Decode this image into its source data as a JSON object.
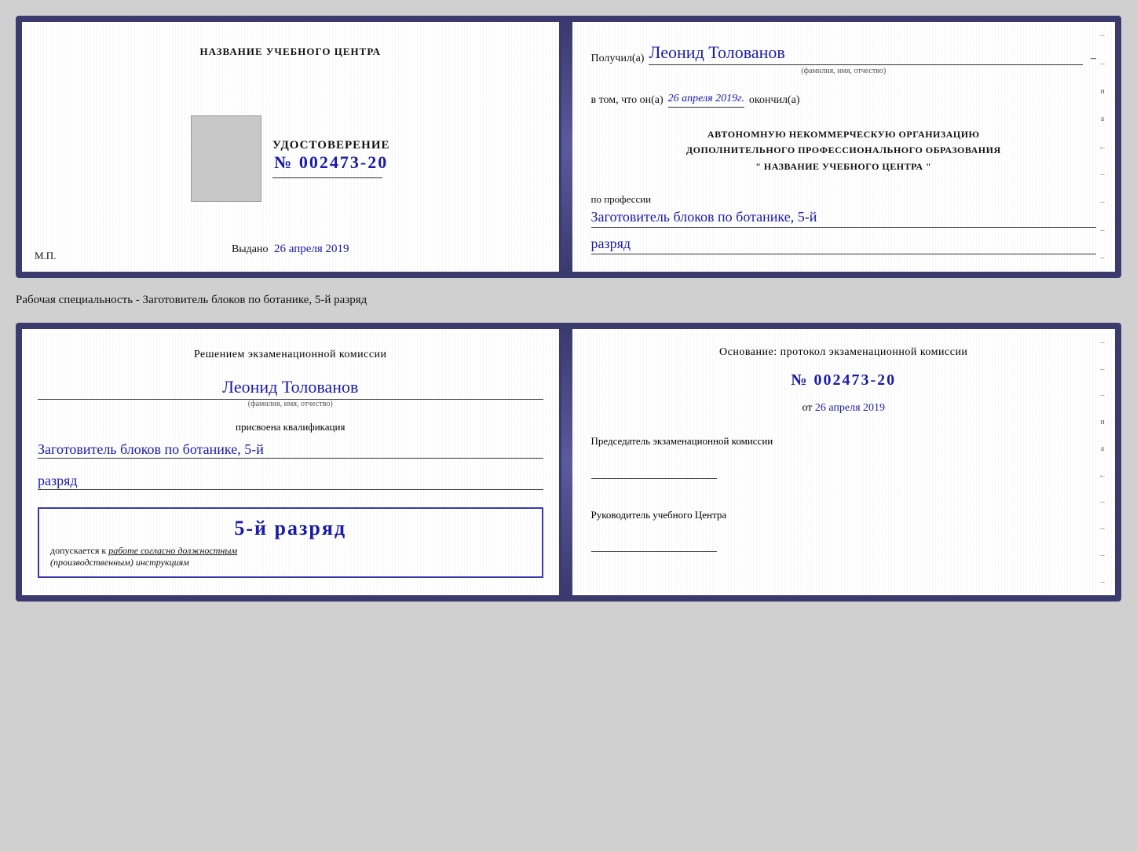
{
  "top_doc": {
    "left": {
      "center_label": "НАЗВАНИЕ УЧЕБНОГО ЦЕНТРА",
      "cert_title": "УДОСТОВЕРЕНИЕ",
      "cert_number": "№ 002473-20",
      "issued_label": "Выдано",
      "issued_date": "26 апреля 2019",
      "mp_label": "М.П."
    },
    "right": {
      "recipient_label": "Получил(а)",
      "recipient_name": "Леонид Толованов",
      "recipient_sub": "(фамилия, имя, отчество)",
      "date_label": "в том, что он(а)",
      "date_value": "26 апреля 2019г.",
      "date_suffix": "окончил(а)",
      "org_line1": "АВТОНОМНУЮ НЕКОММЕРЧЕСКУЮ ОРГАНИЗАЦИЮ",
      "org_line2": "ДОПОЛНИТЕЛЬНОГО ПРОФЕССИОНАЛЬНОГО ОБРАЗОВАНИЯ",
      "org_line3": "\"   НАЗВАНИЕ УЧЕБНОГО ЦЕНТРА   \"",
      "profession_label": "по профессии",
      "profession_name": "Заготовитель блоков по ботанике, 5-й",
      "rank_value": "разряд"
    }
  },
  "specialty_text": "Рабочая специальность - Заготовитель блоков по ботанике, 5-й разряд",
  "bottom_doc": {
    "left": {
      "decision_text": "Решением экзаменационной комиссии",
      "person_name": "Леонид Толованов",
      "person_sub": "(фамилия, имя, отчество)",
      "qualification_label": "присвоена квалификация",
      "qualification_name": "Заготовитель блоков по ботанике, 5-й",
      "rank_value": "разряд",
      "stamp_rank": "5-й разряд",
      "stamp_label": "допускается к",
      "stamp_work": "работе согласно должностным",
      "stamp_italic": "(производственным) инструкциям"
    },
    "right": {
      "basis_label": "Основание: протокол экзаменационной комиссии",
      "basis_number": "№ 002473-20",
      "basis_date_prefix": "от",
      "basis_date": "26 апреля 2019",
      "chairman_label": "Председатель экзаменационной комиссии",
      "director_label": "Руководитель учебного Центра"
    }
  },
  "right_margin_chars": [
    "–",
    "–",
    "и",
    "а",
    "←",
    "–",
    "–",
    "–",
    "–"
  ]
}
